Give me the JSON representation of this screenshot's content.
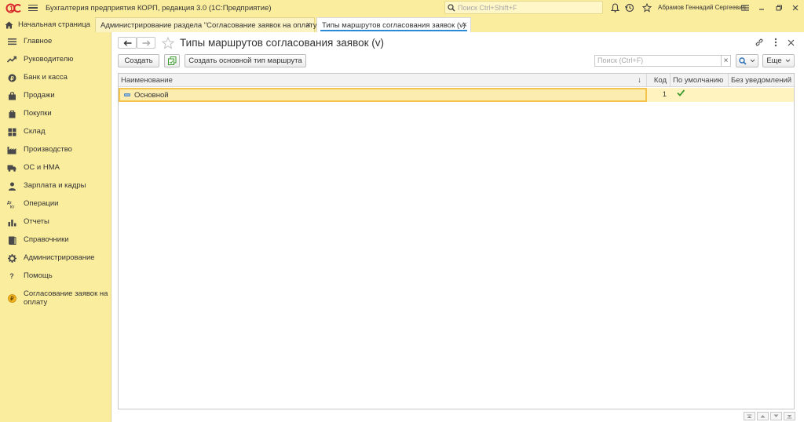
{
  "titlebar": {
    "app_title": "Бухгалтерия предприятия КОРП, редакция 3.0  (1С:Предприятие)",
    "search_placeholder": "Поиск Ctrl+Shift+F",
    "user_name": "Абрамов Геннадий Сергеевич"
  },
  "tabs": {
    "home": "Начальная страница",
    "open": [
      {
        "label": "Администрирование раздела \"Согласование заявок на оплату\"",
        "active": false
      },
      {
        "label": "Типы маршрутов согласования заявок (v)",
        "active": true
      }
    ]
  },
  "sidebar": {
    "items": [
      {
        "label": "Главное",
        "icon": "list-icon"
      },
      {
        "label": "Руководителю",
        "icon": "chart-up-icon"
      },
      {
        "label": "Банк и касса",
        "icon": "bank-icon"
      },
      {
        "label": "Продажи",
        "icon": "bag-icon"
      },
      {
        "label": "Покупки",
        "icon": "cart-icon"
      },
      {
        "label": "Склад",
        "icon": "warehouse-icon"
      },
      {
        "label": "Производство",
        "icon": "factory-icon"
      },
      {
        "label": "ОС и НМА",
        "icon": "truck-icon"
      },
      {
        "label": "Зарплата и кадры",
        "icon": "person-icon"
      },
      {
        "label": "Операции",
        "icon": "dt-kt-icon"
      },
      {
        "label": "Отчеты",
        "icon": "bar-chart-icon"
      },
      {
        "label": "Справочники",
        "icon": "book-icon"
      },
      {
        "label": "Администрирование",
        "icon": "gear-icon"
      },
      {
        "label": "Помощь",
        "icon": "question-icon"
      },
      {
        "label": "Согласование заявок на оплату",
        "icon": "coin-icon"
      }
    ]
  },
  "main": {
    "page_title": "Типы маршрутов согласования заявок (v)",
    "toolbar": {
      "create_label": "Создать",
      "create_main_label": "Создать основной тип маршрута",
      "search_placeholder": "Поиск (Ctrl+F)",
      "clear_label": "×",
      "more_label": "Еще"
    },
    "table": {
      "columns": [
        "Наименование",
        "Код",
        "По умолчанию",
        "Без уведомлений"
      ],
      "sort_indicator": "↓",
      "rows": [
        {
          "name": "Основной",
          "code": "1",
          "default": true,
          "no_notifications": false
        }
      ]
    }
  },
  "colors": {
    "panel_yellow": "#fbed9e",
    "selected_row": "#fcecb0",
    "selected_border": "#f3c34b",
    "accent_blue": "#2b8ad6",
    "check_green": "#3a9b2c"
  }
}
